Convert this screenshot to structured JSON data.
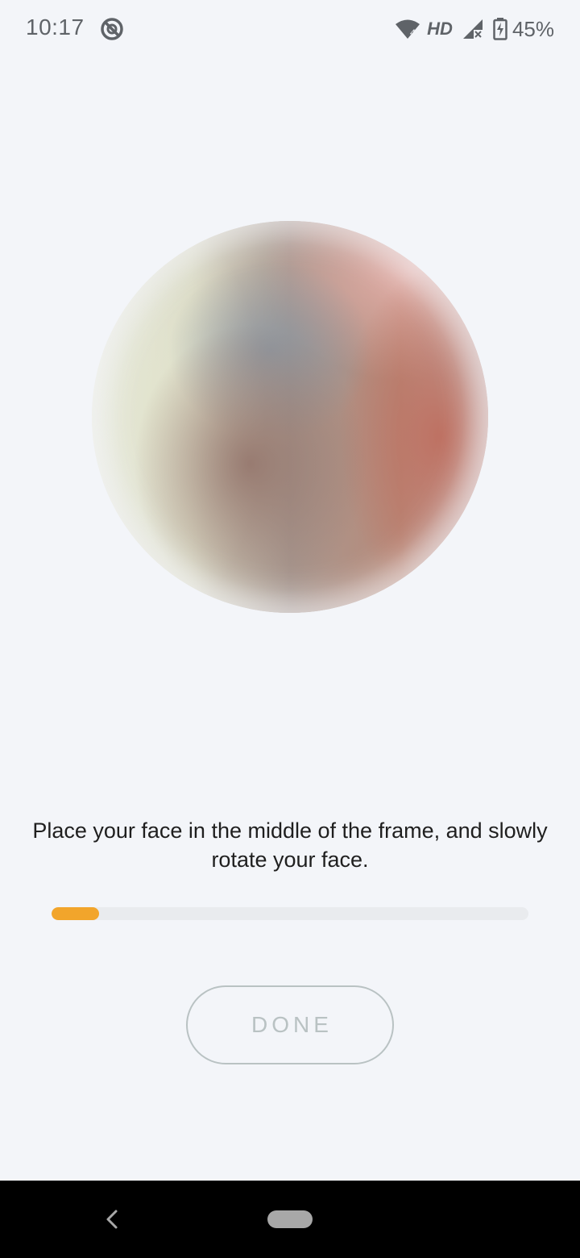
{
  "status_bar": {
    "time": "10:17",
    "app_icon": "blocked-circle-icon",
    "network_label": "HD",
    "wifi_badge": "4",
    "battery_percent": "45%",
    "icons": [
      "wifi-icon",
      "signal-icon",
      "battery-charging-icon"
    ]
  },
  "camera": {
    "preview": "camera-face-preview"
  },
  "instruction": {
    "text": "Place your face in the middle of the frame, and slowly rotate your face."
  },
  "progress": {
    "fraction": 0.1,
    "color": "#f2a52b"
  },
  "actions": {
    "done_label": "DONE"
  },
  "navigation": {
    "back": "back-icon",
    "home": "home-pill-icon"
  }
}
